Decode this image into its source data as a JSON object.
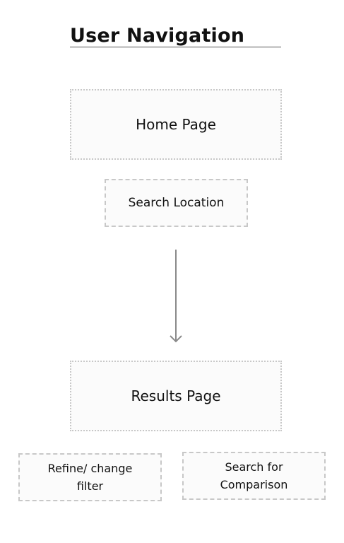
{
  "diagram": {
    "title": "User Navigation",
    "nodes": {
      "home": "Home Page",
      "search_location": "Search Location",
      "results": "Results Page",
      "refine_filter": "Refine/ change filter",
      "search_comparison": "Search for Comparison"
    },
    "colors": {
      "box_border": "#c8c8c8",
      "box_fill": "#fbfbfb",
      "arrow": "#8a8a8a",
      "text": "#111111"
    }
  }
}
